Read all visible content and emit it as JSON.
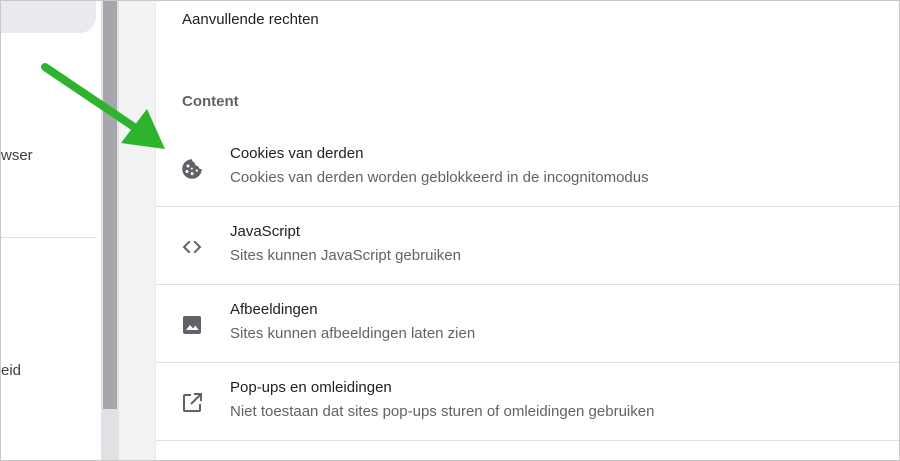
{
  "sidebar": {
    "items": [
      {
        "label": "wser"
      },
      {
        "label": "eid"
      }
    ]
  },
  "panel": {
    "additional_rights_label": "Aanvullende rechten",
    "section_title": "Content",
    "rows": [
      {
        "title": "Cookies van derden",
        "subtitle": "Cookies van derden worden geblokkeerd in de incognitomodus",
        "icon": "cookie-icon"
      },
      {
        "title": "JavaScript",
        "subtitle": "Sites kunnen JavaScript gebruiken",
        "icon": "code-icon"
      },
      {
        "title": "Afbeeldingen",
        "subtitle": "Sites kunnen afbeeldingen laten zien",
        "icon": "image-icon"
      },
      {
        "title": "Pop-ups en omleidingen",
        "subtitle": "Niet toestaan dat sites pop-ups sturen of omleidingen gebruiken",
        "icon": "open-in-new-icon"
      }
    ]
  },
  "colors": {
    "annotation_arrow": "#2db32d",
    "icon": "#5f6368"
  }
}
